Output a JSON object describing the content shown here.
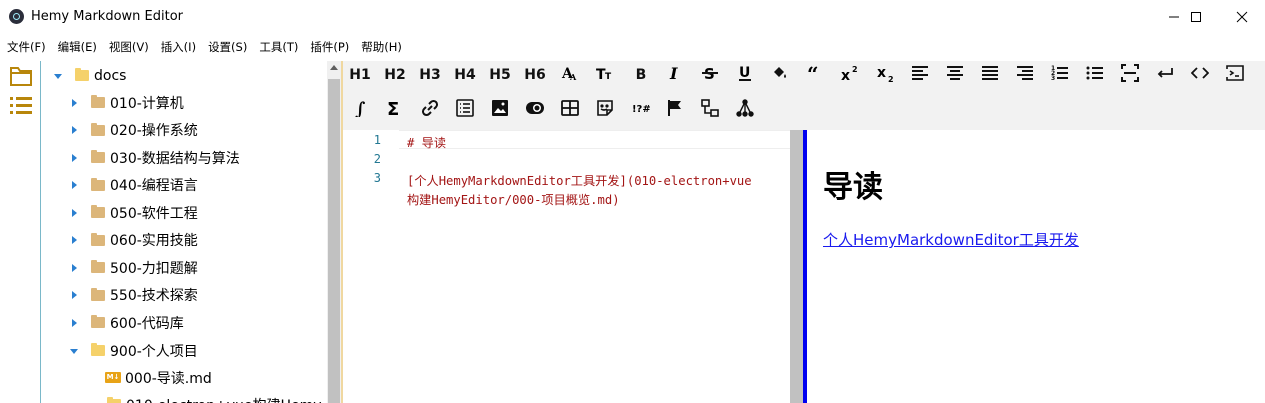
{
  "window": {
    "title": "Hemy Markdown Editor",
    "minimize_glyph": "minimize",
    "maximize_glyph": "maximize",
    "close_glyph": "close"
  },
  "menubar": {
    "items": [
      "文件(F)",
      "编辑(E)",
      "视图(V)",
      "插入(I)",
      "设置(S)",
      "工具(T)",
      "插件(P)",
      "帮助(H)"
    ]
  },
  "activitybar": {
    "icons": [
      "folder-icon",
      "outline-list-icon"
    ],
    "accent_color": "#b8860b"
  },
  "tree": {
    "root": "docs",
    "folders": [
      "010-计算机",
      "020-操作系统",
      "030-数据结构与算法",
      "040-编程语言",
      "050-软件工程",
      "060-实用技能",
      "500-力扣题解",
      "550-技术探索",
      "600-代码库"
    ],
    "expanded_folder": "900-个人项目",
    "file": "000-导读.md",
    "file_badge": "M↓",
    "partial_item": "010-electron+vue构建Hemy"
  },
  "toolbar": {
    "row1": [
      {
        "icon": "heading-1-icon",
        "text": "H1"
      },
      {
        "icon": "heading-2-icon",
        "text": "H2"
      },
      {
        "icon": "heading-3-icon",
        "text": "H3"
      },
      {
        "icon": "heading-4-icon",
        "text": "H4"
      },
      {
        "icon": "heading-5-icon",
        "text": "H5"
      },
      {
        "icon": "heading-6-icon",
        "text": "H6"
      },
      {
        "icon": "font-size-icon",
        "text": ""
      },
      {
        "icon": "text-height-icon",
        "text": ""
      },
      {
        "icon": "bold-icon",
        "text": "B"
      },
      {
        "icon": "italic-icon",
        "text": ""
      },
      {
        "icon": "strikethrough-icon",
        "text": ""
      },
      {
        "icon": "underline-icon",
        "text": ""
      },
      {
        "icon": "highlight-icon",
        "text": ""
      },
      {
        "icon": "quote-icon",
        "text": ""
      },
      {
        "icon": "superscript-icon",
        "text": ""
      },
      {
        "icon": "subscript-icon",
        "text": ""
      },
      {
        "icon": "align-left-icon",
        "text": ""
      },
      {
        "icon": "align-center-icon",
        "text": ""
      },
      {
        "icon": "align-justify-icon",
        "text": ""
      },
      {
        "icon": "align-right-icon",
        "text": ""
      },
      {
        "icon": "ordered-list-icon",
        "text": ""
      },
      {
        "icon": "unordered-list-icon",
        "text": ""
      },
      {
        "icon": "horizontal-rule-icon",
        "text": ""
      },
      {
        "icon": "line-break-icon",
        "text": ""
      },
      {
        "icon": "inline-code-icon",
        "text": ""
      },
      {
        "icon": "code-block-icon",
        "text": ""
      }
    ],
    "row2": [
      {
        "icon": "integral-formula-icon",
        "text": ""
      },
      {
        "icon": "sigma-formula-icon",
        "text": ""
      },
      {
        "icon": "link-icon",
        "text": ""
      },
      {
        "icon": "table-of-contents-icon",
        "text": ""
      },
      {
        "icon": "image-icon",
        "text": ""
      },
      {
        "icon": "toggle-icon",
        "text": ""
      },
      {
        "icon": "table-icon",
        "text": ""
      },
      {
        "icon": "emoji-icon",
        "text": ""
      },
      {
        "icon": "special-chars-icon",
        "text": ""
      },
      {
        "icon": "flag-icon",
        "text": ""
      },
      {
        "icon": "flowchart-icon",
        "text": ""
      },
      {
        "icon": "mindmap-icon",
        "text": ""
      }
    ]
  },
  "editor": {
    "lines": [
      {
        "num": "1",
        "text": "# 导读"
      },
      {
        "num": "2",
        "text": ""
      },
      {
        "num": "3",
        "text": "[个人HemyMarkdownEditor工具开发](010-electron+vue"
      },
      {
        "num": "",
        "text": "构建HemyEditor/000-项目概览.md)"
      }
    ]
  },
  "preview": {
    "heading": "导读",
    "link": "个人HemyMarkdownEditor工具开发"
  }
}
